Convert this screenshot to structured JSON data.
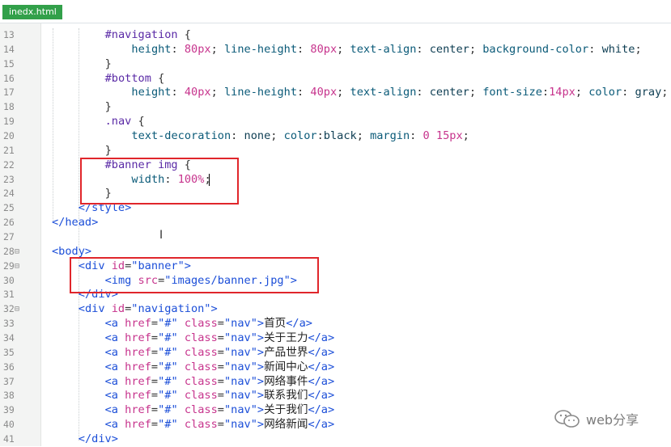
{
  "tab": {
    "filename": "inedx.html"
  },
  "lines": [
    {
      "num": "13",
      "fold": "",
      "indent": 8,
      "tokens": [
        {
          "c": "t-sel",
          "t": "#navigation"
        },
        {
          "c": "t-pun",
          "t": " {"
        }
      ]
    },
    {
      "num": "14",
      "fold": "",
      "indent": 12,
      "tokens": [
        {
          "c": "t-prop",
          "t": "height"
        },
        {
          "c": "t-pun",
          "t": ": "
        },
        {
          "c": "t-num",
          "t": "80px"
        },
        {
          "c": "t-pun",
          "t": "; "
        },
        {
          "c": "t-prop",
          "t": "line-height"
        },
        {
          "c": "t-pun",
          "t": ": "
        },
        {
          "c": "t-num",
          "t": "80px"
        },
        {
          "c": "t-pun",
          "t": "; "
        },
        {
          "c": "t-prop",
          "t": "text-align"
        },
        {
          "c": "t-pun",
          "t": ": "
        },
        {
          "c": "t-val",
          "t": "center"
        },
        {
          "c": "t-pun",
          "t": "; "
        },
        {
          "c": "t-prop",
          "t": "background-color"
        },
        {
          "c": "t-pun",
          "t": ": "
        },
        {
          "c": "t-val",
          "t": "white"
        },
        {
          "c": "t-pun",
          "t": ";"
        }
      ]
    },
    {
      "num": "15",
      "fold": "",
      "indent": 8,
      "tokens": [
        {
          "c": "t-pun",
          "t": "}"
        }
      ]
    },
    {
      "num": "16",
      "fold": "",
      "indent": 8,
      "tokens": [
        {
          "c": "t-sel",
          "t": "#bottom"
        },
        {
          "c": "t-pun",
          "t": " {"
        }
      ]
    },
    {
      "num": "17",
      "fold": "",
      "indent": 12,
      "tokens": [
        {
          "c": "t-prop",
          "t": "height"
        },
        {
          "c": "t-pun",
          "t": ": "
        },
        {
          "c": "t-num",
          "t": "40px"
        },
        {
          "c": "t-pun",
          "t": "; "
        },
        {
          "c": "t-prop",
          "t": "line-height"
        },
        {
          "c": "t-pun",
          "t": ": "
        },
        {
          "c": "t-num",
          "t": "40px"
        },
        {
          "c": "t-pun",
          "t": "; "
        },
        {
          "c": "t-prop",
          "t": "text-align"
        },
        {
          "c": "t-pun",
          "t": ": "
        },
        {
          "c": "t-val",
          "t": "center"
        },
        {
          "c": "t-pun",
          "t": "; "
        },
        {
          "c": "t-prop",
          "t": "font-size"
        },
        {
          "c": "t-pun",
          "t": ":"
        },
        {
          "c": "t-num",
          "t": "14px"
        },
        {
          "c": "t-pun",
          "t": "; "
        },
        {
          "c": "t-prop",
          "t": "color"
        },
        {
          "c": "t-pun",
          "t": ": "
        },
        {
          "c": "t-val",
          "t": "gray"
        },
        {
          "c": "t-pun",
          "t": ";"
        }
      ]
    },
    {
      "num": "18",
      "fold": "",
      "indent": 8,
      "tokens": [
        {
          "c": "t-pun",
          "t": "}"
        }
      ]
    },
    {
      "num": "19",
      "fold": "",
      "indent": 8,
      "tokens": [
        {
          "c": "t-sel",
          "t": ".nav"
        },
        {
          "c": "t-pun",
          "t": " {"
        }
      ]
    },
    {
      "num": "20",
      "fold": "",
      "indent": 12,
      "tokens": [
        {
          "c": "t-prop",
          "t": "text-decoration"
        },
        {
          "c": "t-pun",
          "t": ": "
        },
        {
          "c": "t-val",
          "t": "none"
        },
        {
          "c": "t-pun",
          "t": "; "
        },
        {
          "c": "t-prop",
          "t": "color"
        },
        {
          "c": "t-pun",
          "t": ":"
        },
        {
          "c": "t-val",
          "t": "black"
        },
        {
          "c": "t-pun",
          "t": "; "
        },
        {
          "c": "t-prop",
          "t": "margin"
        },
        {
          "c": "t-pun",
          "t": ": "
        },
        {
          "c": "t-num",
          "t": "0"
        },
        {
          "c": "t-pun",
          "t": " "
        },
        {
          "c": "t-num",
          "t": "15px"
        },
        {
          "c": "t-pun",
          "t": ";"
        }
      ]
    },
    {
      "num": "21",
      "fold": "",
      "indent": 8,
      "tokens": [
        {
          "c": "t-pun",
          "t": "}"
        }
      ]
    },
    {
      "num": "22",
      "fold": "",
      "indent": 8,
      "tokens": [
        {
          "c": "t-sel",
          "t": "#banner img"
        },
        {
          "c": "t-pun",
          "t": " {"
        }
      ]
    },
    {
      "num": "23",
      "fold": "",
      "indent": 12,
      "tokens": [
        {
          "c": "t-prop",
          "t": "width"
        },
        {
          "c": "t-pun",
          "t": ": "
        },
        {
          "c": "t-num",
          "t": "100%"
        },
        {
          "c": "t-pun",
          "t": ";"
        }
      ]
    },
    {
      "num": "24",
      "fold": "",
      "indent": 8,
      "tokens": [
        {
          "c": "t-pun",
          "t": "}"
        }
      ]
    },
    {
      "num": "25",
      "fold": "",
      "indent": 4,
      "tokens": [
        {
          "c": "t-tag",
          "t": "</style>"
        }
      ]
    },
    {
      "num": "26",
      "fold": "",
      "indent": 0,
      "tokens": [
        {
          "c": "t-tag",
          "t": "</head>"
        }
      ]
    },
    {
      "num": "27",
      "fold": "",
      "indent": 0,
      "tokens": []
    },
    {
      "num": "28",
      "fold": "⊟",
      "indent": 0,
      "tokens": [
        {
          "c": "t-tag",
          "t": "<body>"
        }
      ]
    },
    {
      "num": "29",
      "fold": "⊟",
      "indent": 4,
      "tokens": [
        {
          "c": "t-tag",
          "t": "<div "
        },
        {
          "c": "t-attr",
          "t": "id"
        },
        {
          "c": "t-pun",
          "t": "="
        },
        {
          "c": "t-str",
          "t": "\"banner\""
        },
        {
          "c": "t-tag",
          "t": ">"
        }
      ]
    },
    {
      "num": "30",
      "fold": "",
      "indent": 8,
      "tokens": [
        {
          "c": "t-tag",
          "t": "<img "
        },
        {
          "c": "t-attr",
          "t": "src"
        },
        {
          "c": "t-pun",
          "t": "="
        },
        {
          "c": "t-str",
          "t": "\"images/banner.jpg\""
        },
        {
          "c": "t-tag",
          "t": ">"
        }
      ]
    },
    {
      "num": "31",
      "fold": "",
      "indent": 4,
      "tokens": [
        {
          "c": "t-tag",
          "t": "</div>"
        }
      ]
    },
    {
      "num": "32",
      "fold": "⊟",
      "indent": 4,
      "tokens": [
        {
          "c": "t-tag",
          "t": "<div "
        },
        {
          "c": "t-attr",
          "t": "id"
        },
        {
          "c": "t-pun",
          "t": "="
        },
        {
          "c": "t-str",
          "t": "\"navigation\""
        },
        {
          "c": "t-tag",
          "t": ">"
        }
      ]
    },
    {
      "num": "33",
      "fold": "",
      "indent": 8,
      "tokens": [
        {
          "c": "t-tag",
          "t": "<a "
        },
        {
          "c": "t-attr",
          "t": "href"
        },
        {
          "c": "t-pun",
          "t": "="
        },
        {
          "c": "t-str",
          "t": "\"#\""
        },
        {
          "c": "t-pun",
          "t": " "
        },
        {
          "c": "t-attr",
          "t": "class"
        },
        {
          "c": "t-pun",
          "t": "="
        },
        {
          "c": "t-str",
          "t": "\"nav\""
        },
        {
          "c": "t-tag",
          "t": ">"
        },
        {
          "c": "t-txt",
          "t": "首页"
        },
        {
          "c": "t-tag",
          "t": "</a>"
        }
      ]
    },
    {
      "num": "34",
      "fold": "",
      "indent": 8,
      "tokens": [
        {
          "c": "t-tag",
          "t": "<a "
        },
        {
          "c": "t-attr",
          "t": "href"
        },
        {
          "c": "t-pun",
          "t": "="
        },
        {
          "c": "t-str",
          "t": "\"#\""
        },
        {
          "c": "t-pun",
          "t": " "
        },
        {
          "c": "t-attr",
          "t": "class"
        },
        {
          "c": "t-pun",
          "t": "="
        },
        {
          "c": "t-str",
          "t": "\"nav\""
        },
        {
          "c": "t-tag",
          "t": ">"
        },
        {
          "c": "t-txt",
          "t": "关于王力"
        },
        {
          "c": "t-tag",
          "t": "</a>"
        }
      ]
    },
    {
      "num": "35",
      "fold": "",
      "indent": 8,
      "tokens": [
        {
          "c": "t-tag",
          "t": "<a "
        },
        {
          "c": "t-attr",
          "t": "href"
        },
        {
          "c": "t-pun",
          "t": "="
        },
        {
          "c": "t-str",
          "t": "\"#\""
        },
        {
          "c": "t-pun",
          "t": " "
        },
        {
          "c": "t-attr",
          "t": "class"
        },
        {
          "c": "t-pun",
          "t": "="
        },
        {
          "c": "t-str",
          "t": "\"nav\""
        },
        {
          "c": "t-tag",
          "t": ">"
        },
        {
          "c": "t-txt",
          "t": "产品世界"
        },
        {
          "c": "t-tag",
          "t": "</a>"
        }
      ]
    },
    {
      "num": "36",
      "fold": "",
      "indent": 8,
      "tokens": [
        {
          "c": "t-tag",
          "t": "<a "
        },
        {
          "c": "t-attr",
          "t": "href"
        },
        {
          "c": "t-pun",
          "t": "="
        },
        {
          "c": "t-str",
          "t": "\"#\""
        },
        {
          "c": "t-pun",
          "t": " "
        },
        {
          "c": "t-attr",
          "t": "class"
        },
        {
          "c": "t-pun",
          "t": "="
        },
        {
          "c": "t-str",
          "t": "\"nav\""
        },
        {
          "c": "t-tag",
          "t": ">"
        },
        {
          "c": "t-txt",
          "t": "新闻中心"
        },
        {
          "c": "t-tag",
          "t": "</a>"
        }
      ]
    },
    {
      "num": "37",
      "fold": "",
      "indent": 8,
      "tokens": [
        {
          "c": "t-tag",
          "t": "<a "
        },
        {
          "c": "t-attr",
          "t": "href"
        },
        {
          "c": "t-pun",
          "t": "="
        },
        {
          "c": "t-str",
          "t": "\"#\""
        },
        {
          "c": "t-pun",
          "t": " "
        },
        {
          "c": "t-attr",
          "t": "class"
        },
        {
          "c": "t-pun",
          "t": "="
        },
        {
          "c": "t-str",
          "t": "\"nav\""
        },
        {
          "c": "t-tag",
          "t": ">"
        },
        {
          "c": "t-txt",
          "t": "网络事件"
        },
        {
          "c": "t-tag",
          "t": "</a>"
        }
      ]
    },
    {
      "num": "38",
      "fold": "",
      "indent": 8,
      "tokens": [
        {
          "c": "t-tag",
          "t": "<a "
        },
        {
          "c": "t-attr",
          "t": "href"
        },
        {
          "c": "t-pun",
          "t": "="
        },
        {
          "c": "t-str",
          "t": "\"#\""
        },
        {
          "c": "t-pun",
          "t": " "
        },
        {
          "c": "t-attr",
          "t": "class"
        },
        {
          "c": "t-pun",
          "t": "="
        },
        {
          "c": "t-str",
          "t": "\"nav\""
        },
        {
          "c": "t-tag",
          "t": ">"
        },
        {
          "c": "t-txt",
          "t": "联系我们"
        },
        {
          "c": "t-tag",
          "t": "</a>"
        }
      ]
    },
    {
      "num": "39",
      "fold": "",
      "indent": 8,
      "tokens": [
        {
          "c": "t-tag",
          "t": "<a "
        },
        {
          "c": "t-attr",
          "t": "href"
        },
        {
          "c": "t-pun",
          "t": "="
        },
        {
          "c": "t-str",
          "t": "\"#\""
        },
        {
          "c": "t-pun",
          "t": " "
        },
        {
          "c": "t-attr",
          "t": "class"
        },
        {
          "c": "t-pun",
          "t": "="
        },
        {
          "c": "t-str",
          "t": "\"nav\""
        },
        {
          "c": "t-tag",
          "t": ">"
        },
        {
          "c": "t-txt",
          "t": "关于我们"
        },
        {
          "c": "t-tag",
          "t": "</a>"
        }
      ]
    },
    {
      "num": "40",
      "fold": "",
      "indent": 8,
      "tokens": [
        {
          "c": "t-tag",
          "t": "<a "
        },
        {
          "c": "t-attr",
          "t": "href"
        },
        {
          "c": "t-pun",
          "t": "="
        },
        {
          "c": "t-str",
          "t": "\"#\""
        },
        {
          "c": "t-pun",
          "t": " "
        },
        {
          "c": "t-attr",
          "t": "class"
        },
        {
          "c": "t-pun",
          "t": "="
        },
        {
          "c": "t-str",
          "t": "\"nav\""
        },
        {
          "c": "t-tag",
          "t": ">"
        },
        {
          "c": "t-txt",
          "t": "网络新闻"
        },
        {
          "c": "t-tag",
          "t": "</a>"
        }
      ]
    },
    {
      "num": "41",
      "fold": "",
      "indent": 4,
      "tokens": [
        {
          "c": "t-tag",
          "t": "</div>"
        }
      ]
    }
  ],
  "watermark": {
    "text": "web分享",
    "icon": "wechat-icon"
  },
  "colors": {
    "tab": "#32a04a",
    "highlight_box": "#e0262b"
  }
}
